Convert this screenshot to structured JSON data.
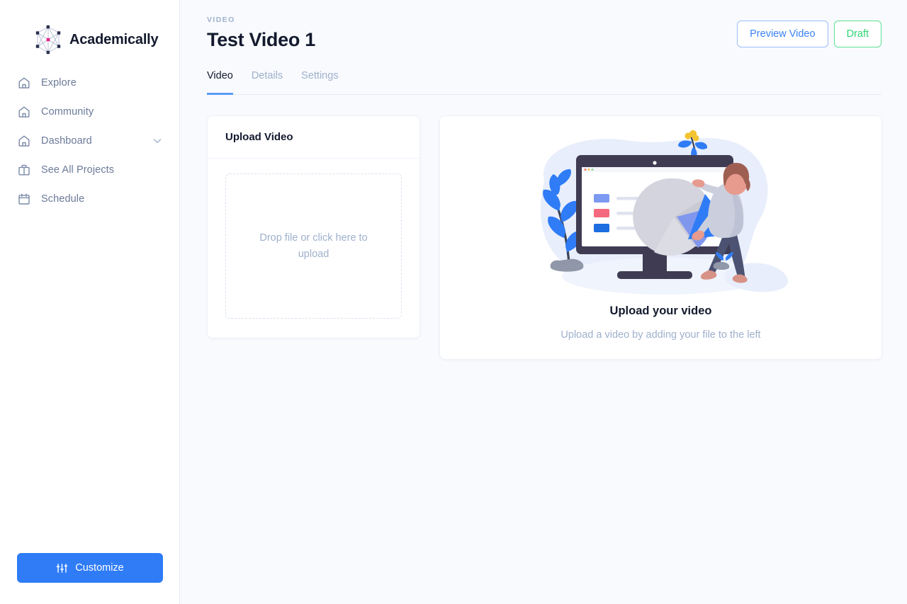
{
  "brand": {
    "name": "Academically",
    "logo_icon": "hexagon-network-icon",
    "accent": "#e91e8c"
  },
  "sidebar": {
    "items": [
      {
        "label": "Explore",
        "icon": "home-icon",
        "expandable": false
      },
      {
        "label": "Community",
        "icon": "home-icon",
        "expandable": false
      },
      {
        "label": "Dashboard",
        "icon": "home-icon",
        "expandable": true,
        "chevron_icon": "chevron-down-icon"
      },
      {
        "label": "See All Projects",
        "icon": "briefcase-icon",
        "expandable": false
      },
      {
        "label": "Schedule",
        "icon": "calendar-icon",
        "expandable": false
      }
    ],
    "customize": {
      "label": "Customize",
      "icon": "sliders-icon",
      "color": "#2f7cf6"
    }
  },
  "header": {
    "eyebrow": "VIDEO",
    "title": "Test Video 1",
    "actions": [
      {
        "label": "Preview Video",
        "style": "outline-blue",
        "color": "#3b82f6"
      },
      {
        "label": "Draft",
        "style": "outline-green",
        "color": "#2ed573"
      }
    ]
  },
  "tabs": [
    {
      "label": "Video",
      "active": true
    },
    {
      "label": "Details",
      "active": false
    },
    {
      "label": "Settings",
      "active": false
    }
  ],
  "upload_card": {
    "title": "Upload Video",
    "dropzone_text": "Drop file or click here to upload"
  },
  "preview_card": {
    "illustration": "person-pulling-pie-chart-slice-from-monitor-illustration",
    "title": "Upload your video",
    "subtitle": "Upload a video by adding your file to the left"
  },
  "colors": {
    "page_background": "#f8fafd",
    "sidebar_background": "#ffffff",
    "card_background": "#ffffff",
    "text_primary": "#131a2e",
    "text_muted": "#9fb0cc",
    "accent_blue": "#2f7cf6",
    "accent_green": "#2ed573",
    "tab_underline": "#5b9bf8"
  }
}
